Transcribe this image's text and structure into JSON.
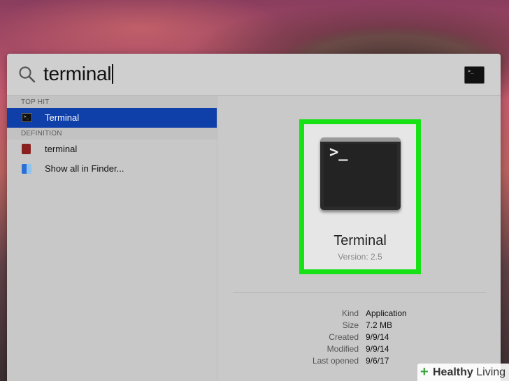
{
  "search": {
    "query": "terminal"
  },
  "results": {
    "sections": [
      {
        "header": "TOP HIT",
        "items": [
          {
            "label": "Terminal",
            "icon": "terminal-app-icon",
            "selected": true
          }
        ]
      },
      {
        "header": "DEFINITION",
        "items": [
          {
            "label": "terminal",
            "icon": "dictionary-icon",
            "selected": false
          },
          {
            "label": "Show all in Finder...",
            "icon": "finder-icon",
            "selected": false
          }
        ]
      }
    ]
  },
  "terminal_prompt_glyph": ">_",
  "preview": {
    "app_name": "Terminal",
    "version": "Version: 2.5",
    "highlight_color": "#16e216",
    "details": [
      {
        "key": "Kind",
        "value": "Application"
      },
      {
        "key": "Size",
        "value": "7.2 MB"
      },
      {
        "key": "Created",
        "value": "9/9/14"
      },
      {
        "key": "Modified",
        "value": "9/9/14"
      },
      {
        "key": "Last opened",
        "value": "9/6/17"
      }
    ]
  },
  "watermark": {
    "bold": "Healthy",
    "rest": " Living"
  },
  "colors": {
    "selection": "#0f3fa8",
    "panel": "#c8c8c8"
  }
}
